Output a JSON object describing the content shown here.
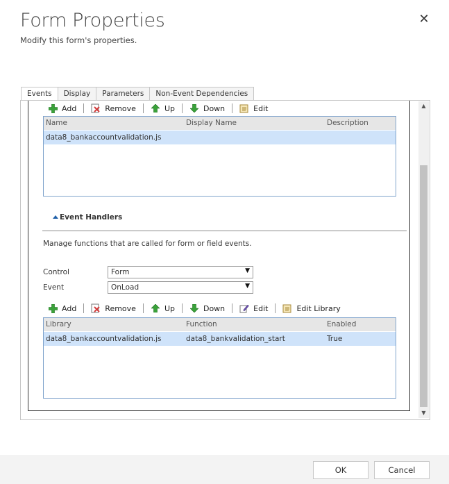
{
  "dialog": {
    "title": "Form Properties",
    "subtitle": "Modify this form's properties.",
    "close_glyph": "✕"
  },
  "tabs": [
    {
      "label": "Events",
      "active": true
    },
    {
      "label": "Display",
      "active": false
    },
    {
      "label": "Parameters",
      "active": false
    },
    {
      "label": "Non-Event Dependencies",
      "active": false
    }
  ],
  "library_toolbar": {
    "add": "Add",
    "remove": "Remove",
    "up": "Up",
    "down": "Down",
    "edit": "Edit"
  },
  "library_grid": {
    "columns": [
      "Name",
      "Display Name",
      "Description"
    ],
    "rows": [
      {
        "name": "data8_bankaccountvalidation.js",
        "display_name": "",
        "description": ""
      }
    ]
  },
  "event_handlers": {
    "heading": "Event Handlers",
    "description": "Manage functions that are called for form or field events.",
    "control_label": "Control",
    "control_value": "Form",
    "event_label": "Event",
    "event_value": "OnLoad",
    "select_arrow": "▼"
  },
  "handler_toolbar": {
    "add": "Add",
    "remove": "Remove",
    "up": "Up",
    "down": "Down",
    "edit": "Edit",
    "edit_library": "Edit Library"
  },
  "handler_grid": {
    "columns": [
      "Library",
      "Function",
      "Enabled"
    ],
    "rows": [
      {
        "library": "data8_bankaccountvalidation.js",
        "function": "data8_bankvalidation_start",
        "enabled": "True"
      }
    ]
  },
  "scrollbar": {
    "up_glyph": "▲",
    "down_glyph": "▼"
  },
  "footer": {
    "ok": "OK",
    "cancel": "Cancel"
  },
  "colors": {
    "accent": "#1f5fa8",
    "selected_row": "#cfe3fa",
    "grid_border": "#7fa3cc",
    "add_green": "#3aa23a",
    "remove_red": "#d23c3c"
  }
}
